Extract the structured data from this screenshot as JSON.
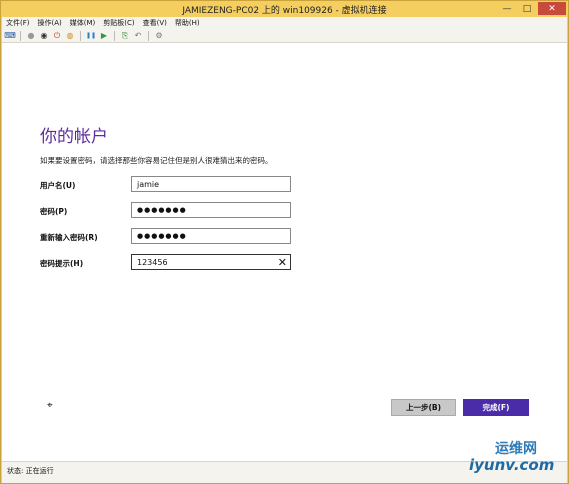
{
  "window": {
    "title": "JAMIEZENG-PC02 上的 win109926 - 虚拟机连接",
    "min": "—",
    "max": "□",
    "close": "✕"
  },
  "menu": {
    "file": "文件(F)",
    "action": "操作(A)",
    "media": "媒体(M)",
    "clipboard": "剪贴板(C)",
    "view": "查看(V)",
    "help": "帮助(H)"
  },
  "toolbar": {
    "icons": [
      "ctrl-alt-del-icon",
      "start-icon",
      "turnoff-icon",
      "shutdown-icon",
      "save-icon",
      "pause-icon",
      "resume-icon",
      "checkpoint-icon",
      "revert-icon",
      "enhanced-session-icon"
    ],
    "glyphs": {
      "ctrl_alt_del": "⌨",
      "start": "●",
      "turnoff": "◉",
      "shutdown": "⏻",
      "save": "◍",
      "pause": "❚❚",
      "resume": "▶",
      "checkpoint": "⎘",
      "revert": "↶",
      "enhanced": "⚙"
    }
  },
  "page": {
    "heading": "你的帐户",
    "description": "如果要设置密码，请选择那些你容易记住但是别人很难猜出来的密码。",
    "fields": {
      "username": {
        "label": "用户名(U)",
        "value": "jamie"
      },
      "password": {
        "label": "密码(P)",
        "value": "●●●●●●●"
      },
      "confirm": {
        "label": "重新输入密码(R)",
        "value": "●●●●●●●"
      },
      "hint": {
        "label": "密码提示(H)",
        "value": "123456",
        "clear": "✕"
      }
    },
    "cursor": "⌖",
    "back_label": "上一步(B)",
    "finish_label": "完成(F)"
  },
  "status": {
    "text": "状态: 正在运行"
  },
  "watermark": {
    "top": "运维网",
    "bottom": "iyunv.com"
  },
  "colors": {
    "accent": "#5b2c9c",
    "finish_button": "#4a2ca8",
    "frame": "#f4cf60"
  }
}
